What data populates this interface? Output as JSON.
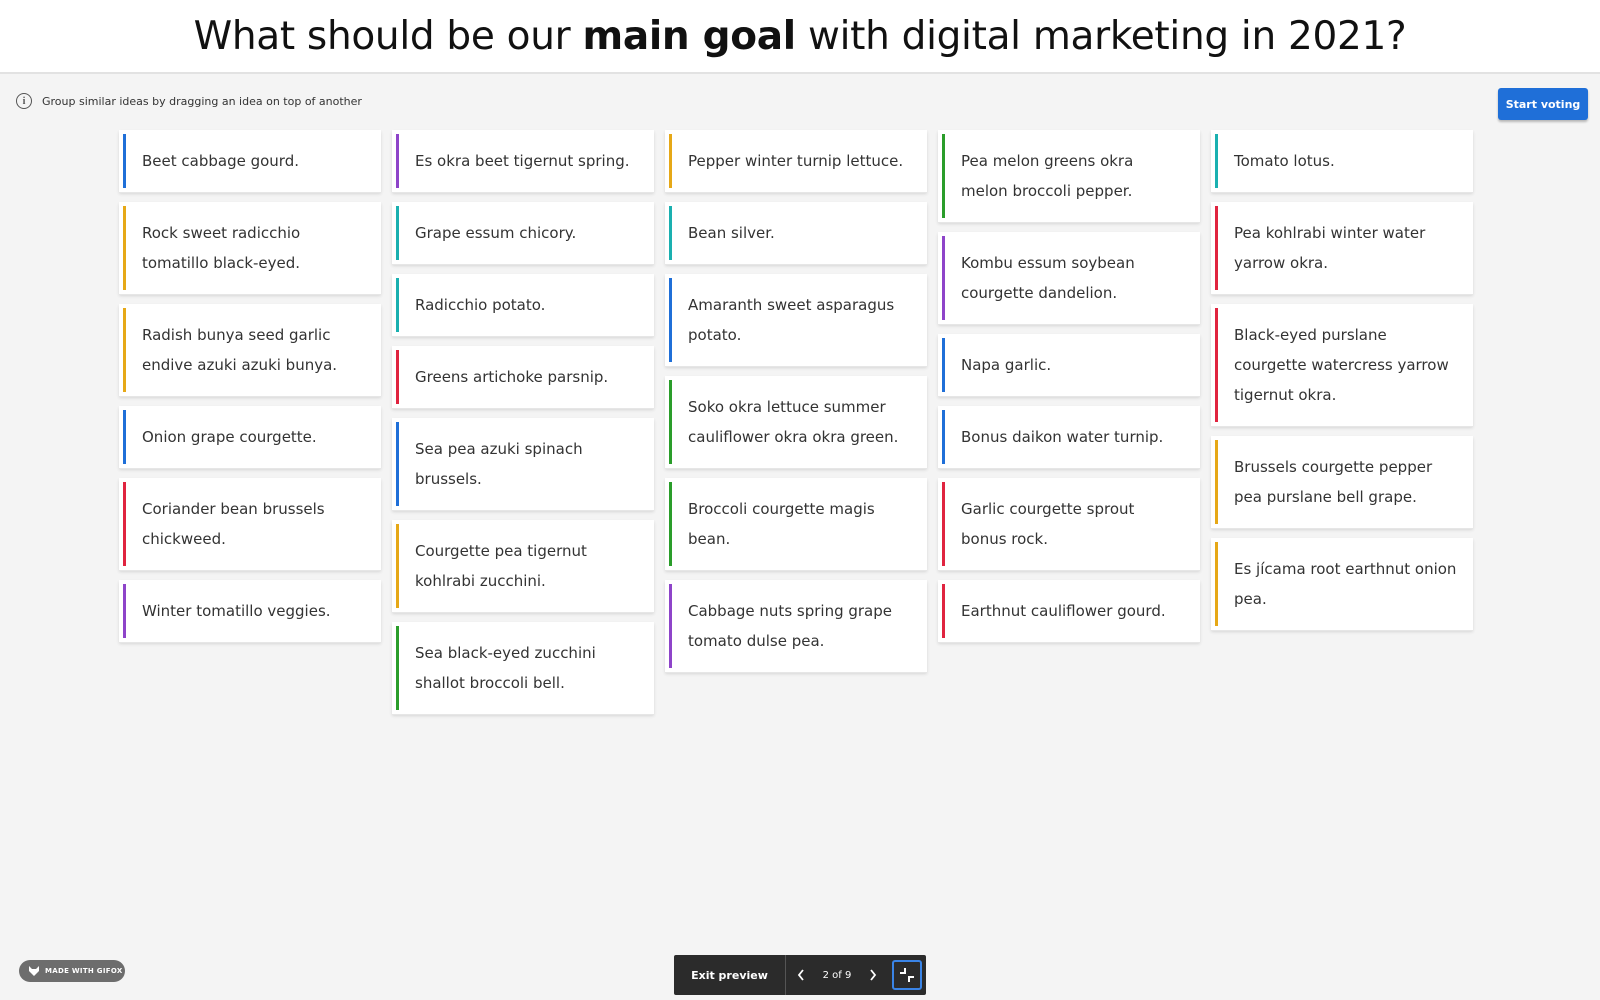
{
  "header": {
    "title_part1": "What should be our ",
    "title_strong": "main goal",
    "title_part2": " with digital marketing in 2021?"
  },
  "hint": {
    "text": "Group similar ideas by dragging an idea on top of another",
    "icon": "info-icon"
  },
  "start_button": {
    "label": "Start voting",
    "color": "#1f6fd8"
  },
  "columns": [
    [
      {
        "text": "Beet cabbage gourd.",
        "color": "#1f6fd8"
      },
      {
        "text": "Rock sweet radicchio tomatillo black-eyed.",
        "color": "#e6a817"
      },
      {
        "text": "Radish bunya seed garlic endive azuki azuki bunya.",
        "color": "#e6a817"
      },
      {
        "text": "Onion grape courgette.",
        "color": "#1f6fd8"
      },
      {
        "text": "Coriander bean brussels chickweed.",
        "color": "#e0243f"
      },
      {
        "text": "Winter tomatillo veggies.",
        "color": "#8e44c9"
      }
    ],
    [
      {
        "text": "Es okra beet tigernut spring.",
        "color": "#8e44c9"
      },
      {
        "text": "Grape essum chicory.",
        "color": "#1ab0b0"
      },
      {
        "text": "Radicchio potato.",
        "color": "#1ab0b0"
      },
      {
        "text": "Greens artichoke parsnip.",
        "color": "#e0243f"
      },
      {
        "text": "Sea pea azuki spinach brussels.",
        "color": "#1f6fd8"
      },
      {
        "text": "Courgette pea tigernut kohlrabi zucchini.",
        "color": "#e6a817"
      },
      {
        "text": "Sea black-eyed zucchini shallot broccoli bell.",
        "color": "#2a9d2a"
      }
    ],
    [
      {
        "text": "Pepper winter turnip lettuce.",
        "color": "#e6a817"
      },
      {
        "text": "Bean silver.",
        "color": "#1ab0b0"
      },
      {
        "text": "Amaranth sweet asparagus potato.",
        "color": "#1f6fd8"
      },
      {
        "text": "Soko okra lettuce summer cauliflower okra okra green.",
        "color": "#2a9d2a"
      },
      {
        "text": "Broccoli courgette magis bean.",
        "color": "#2a9d2a"
      },
      {
        "text": "Cabbage nuts spring grape tomato dulse pea.",
        "color": "#8e44c9"
      }
    ],
    [
      {
        "text": "Pea melon greens okra melon broccoli pepper.",
        "color": "#2a9d2a"
      },
      {
        "text": "Kombu essum soybean courgette dandelion.",
        "color": "#8e44c9"
      },
      {
        "text": "Napa garlic.",
        "color": "#1f6fd8"
      },
      {
        "text": "Bonus daikon water turnip.",
        "color": "#1f6fd8"
      },
      {
        "text": "Garlic courgette sprout bonus rock.",
        "color": "#e0243f"
      },
      {
        "text": "Earthnut cauliflower gourd.",
        "color": "#e0243f"
      }
    ],
    [
      {
        "text": "Tomato lotus.",
        "color": "#1ab0b0"
      },
      {
        "text": "Pea kohlrabi winter water yarrow okra.",
        "color": "#e0243f"
      },
      {
        "text": "Black-eyed purslane courgette watercress yarrow tigernut okra.",
        "color": "#e0243f"
      },
      {
        "text": "Brussels courgette pepper pea purslane bell grape.",
        "color": "#e6a817"
      },
      {
        "text": "Es jícama root earthnut onion pea.",
        "color": "#e6a817"
      }
    ]
  ],
  "badge": {
    "text": "MADE WITH GIFOX",
    "icon": "fox-icon"
  },
  "preview_bar": {
    "exit_label": "Exit preview",
    "page_indicator": "2 of 9",
    "prev_icon": "chevron-left-icon",
    "next_icon": "chevron-right-icon",
    "fullscreen_icon": "exit-fullscreen-icon"
  }
}
